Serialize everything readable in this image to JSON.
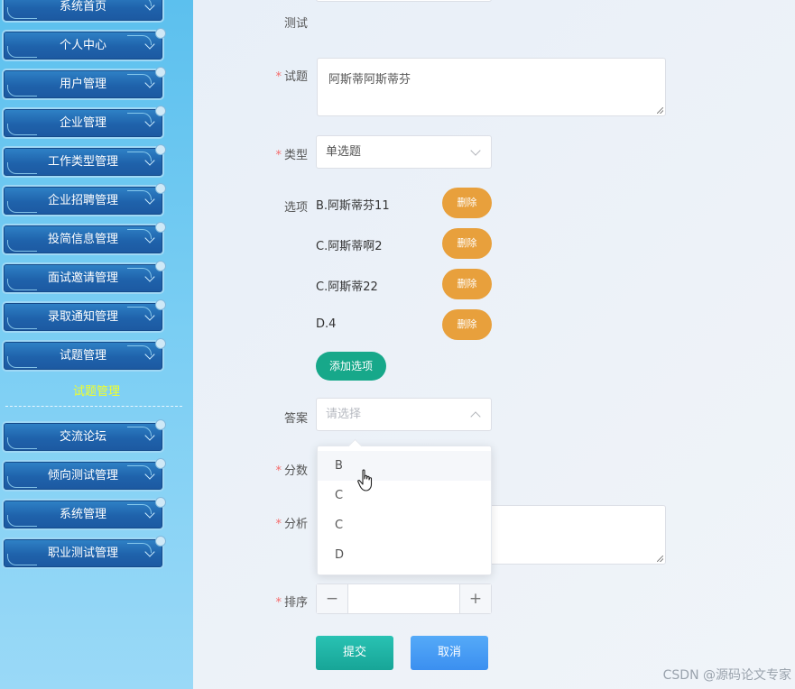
{
  "sidebar": {
    "items": [
      {
        "label": "系统首页"
      },
      {
        "label": "个人中心"
      },
      {
        "label": "用户管理"
      },
      {
        "label": "企业管理"
      },
      {
        "label": "工作类型管理"
      },
      {
        "label": "企业招聘管理"
      },
      {
        "label": "投简信息管理"
      },
      {
        "label": "面试邀请管理"
      },
      {
        "label": "录取通知管理"
      },
      {
        "label": "试题管理"
      },
      {
        "label": "交流论坛"
      },
      {
        "label": "倾向测试管理"
      },
      {
        "label": "系统管理"
      },
      {
        "label": "职业测试管理"
      }
    ],
    "active_submenu_label": "试题管理",
    "active_color": "#f2ff28"
  },
  "form": {
    "top_label": "测试",
    "question": {
      "label": "试题",
      "value": "阿斯蒂阿斯蒂芬",
      "required": true
    },
    "type": {
      "label": "类型",
      "value": "单选题",
      "required": true
    },
    "options": {
      "label": "选项",
      "items": [
        {
          "text": "B.阿斯蒂芬11",
          "delete_label": "删除"
        },
        {
          "text": "C.阿斯蒂啊2",
          "delete_label": "删除"
        },
        {
          "text": "C.阿斯蒂22",
          "delete_label": "删除"
        },
        {
          "text": "D.4",
          "delete_label": "删除"
        }
      ],
      "add_label": "添加选项"
    },
    "answer": {
      "label": "答案",
      "placeholder": "请选择",
      "dropdown_open": true,
      "dropdown_options": [
        "B",
        "C",
        "C",
        "D"
      ],
      "hovered_option": "B"
    },
    "score": {
      "label": "分数",
      "required": true
    },
    "analysis": {
      "label": "分析",
      "required": true
    },
    "sort": {
      "label": "排序",
      "required": true,
      "value": "",
      "minus": "−",
      "plus": "+"
    },
    "submit_label": "提交",
    "cancel_label": "取消"
  },
  "colors": {
    "delete_button": "#e8a03c",
    "add_button": "#17a88a",
    "submit_button": "#1fb3a5",
    "cancel_button": "#4a9cf4",
    "required_star": "#f56c6c"
  },
  "icons": {
    "cursor": "hand-pointer-icon"
  },
  "watermark": "CSDN @源码论文专家"
}
